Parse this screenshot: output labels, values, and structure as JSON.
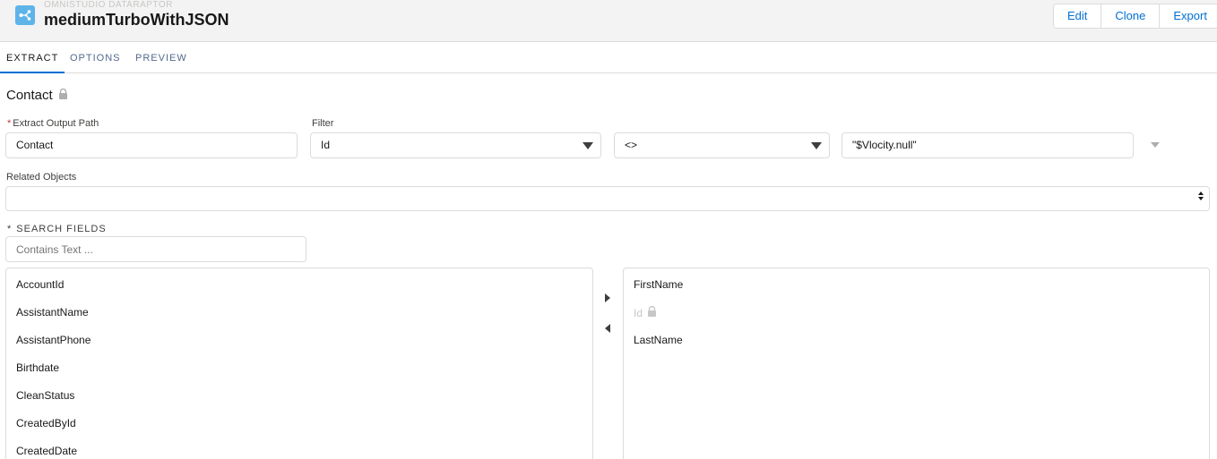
{
  "header": {
    "eyebrow": "OMNISTUDIO DATARAPTOR",
    "title": "mediumTurboWithJSON",
    "app_icon": "dataraptor-icon",
    "buttons": [
      "Edit",
      "Clone",
      "Export"
    ]
  },
  "tabs": [
    {
      "label": "EXTRACT",
      "active": true
    },
    {
      "label": "OPTIONS",
      "active": false
    },
    {
      "label": "PREVIEW",
      "active": false
    }
  ],
  "object": {
    "name": "Contact",
    "lock_icon": "lock-icon"
  },
  "extract_output_path": {
    "required_marker": "*",
    "label": "Extract Output Path",
    "value": "Contact"
  },
  "filter": {
    "label": "Filter",
    "field_value": "Id",
    "operator_value": "<>",
    "value_text": "\"$Vlocity.null\""
  },
  "related_objects": {
    "label": "Related Objects",
    "value": ""
  },
  "search_fields": {
    "required_marker": "*",
    "label": "SEARCH FIELDS",
    "placeholder": "Contains Text ..."
  },
  "available_fields": [
    "AccountId",
    "AssistantName",
    "AssistantPhone",
    "Birthdate",
    "CleanStatus",
    "CreatedById",
    "CreatedDate"
  ],
  "selected_fields": [
    {
      "label": "FirstName",
      "locked": false
    },
    {
      "label": "Id",
      "locked": true
    },
    {
      "label": "LastName",
      "locked": false
    }
  ],
  "colors": {
    "accent": "#0070d2",
    "header_bg": "#f3f3f3",
    "icon_bg": "#5eb4e8",
    "border": "#dddbda"
  }
}
